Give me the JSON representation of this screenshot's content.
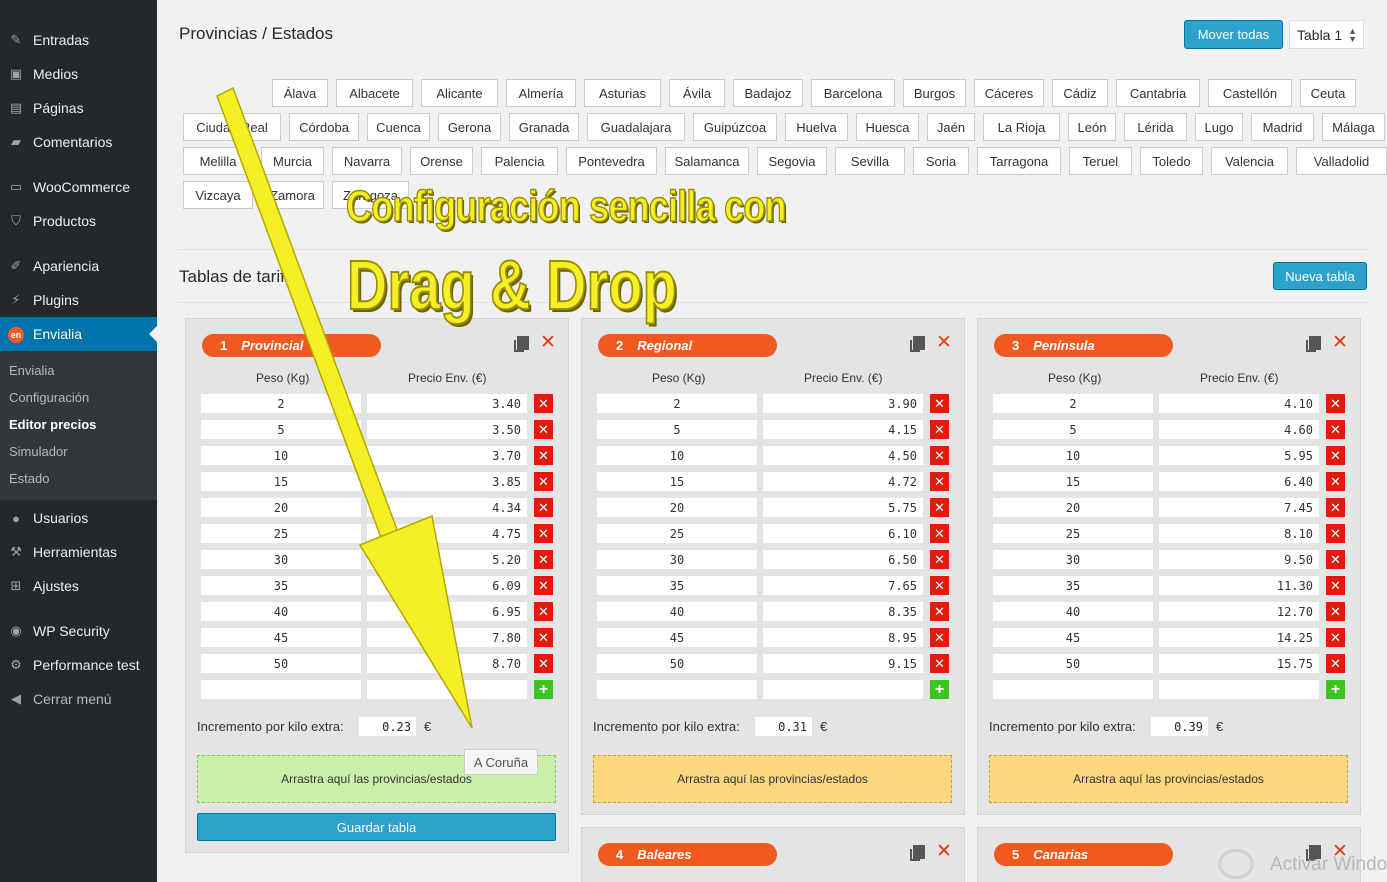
{
  "sidebar": {
    "items": [
      {
        "label": "Entradas",
        "icon": "pushpin-icon"
      },
      {
        "label": "Medios",
        "icon": "media-icon"
      },
      {
        "label": "Páginas",
        "icon": "page-icon"
      },
      {
        "label": "Comentarios",
        "icon": "comment-icon"
      },
      {
        "label": "WooCommerce",
        "icon": "woocommerce-icon"
      },
      {
        "label": "Productos",
        "icon": "cart-icon"
      },
      {
        "label": "Apariencia",
        "icon": "brush-icon"
      },
      {
        "label": "Plugins",
        "icon": "plug-icon"
      },
      {
        "label": "Envialia",
        "icon": "envialia-icon",
        "badge": "en"
      },
      {
        "label": "Usuarios",
        "icon": "user-icon"
      },
      {
        "label": "Herramientas",
        "icon": "wrench-icon"
      },
      {
        "label": "Ajustes",
        "icon": "settings-icon"
      },
      {
        "label": "WP Security",
        "icon": "security-icon"
      },
      {
        "label": "Performance test",
        "icon": "gear-icon"
      },
      {
        "label": "Cerrar menú",
        "icon": "collapse-icon"
      }
    ],
    "submenu": [
      "Envialia",
      "Configuración",
      "Editor precios",
      "Simulador",
      "Estado"
    ]
  },
  "provinces": {
    "title": "Provincias / Estados",
    "move_all_label": "Mover todas",
    "table_select": "Tabla 1",
    "rows": [
      [
        "Álava",
        "Albacete",
        "Alicante",
        "Almería",
        "Asturias",
        "Ávila",
        "Badajoz",
        "Barcelona",
        "Burgos",
        "Cáceres",
        "Cádiz",
        "Cantabria",
        "Castellón",
        "Ceuta"
      ],
      [
        "Ciudad Real",
        "Córdoba",
        "Cuenca",
        "Gerona",
        "Granada",
        "Guadalajara",
        "Guipúzcoa",
        "Huelva",
        "Huesca",
        "Jaén",
        "La Rioja",
        "León",
        "Lérida",
        "Lugo",
        "Madrid",
        "Málaga"
      ],
      [
        "Melilla",
        "Murcia",
        "Navarra",
        "Orense",
        "Palencia",
        "Pontevedra",
        "Salamanca",
        "Segovia",
        "Sevilla",
        "Soria",
        "Tarragona",
        "Teruel",
        "Toledo",
        "Valencia",
        "Valladolid"
      ],
      [
        "Vizcaya",
        "Zamora",
        "Zaragoza"
      ]
    ]
  },
  "tables_section": {
    "title": "Tablas de tarifas",
    "new_table_label": "Nueva tabla",
    "weight_header": "Peso (Kg)",
    "price_header": "Precio Env. (€)",
    "increment_label": "Incremento por kilo extra:",
    "currency": "€",
    "dropzone_label": "Arrastra aquí las provincias/estados",
    "save_label": "Guardar tabla",
    "dragging_chip": "A Coruña",
    "weights": [
      "2",
      "5",
      "10",
      "15",
      "20",
      "25",
      "30",
      "35",
      "40",
      "45",
      "50"
    ],
    "cards": [
      {
        "num": "1",
        "name": "Provincial",
        "prices": [
          "3.40",
          "3.50",
          "3.70",
          "3.85",
          "4.34",
          "4.75",
          "5.20",
          "6.09",
          "6.95",
          "7.80",
          "8.70"
        ],
        "increment": "0.23"
      },
      {
        "num": "2",
        "name": "Regional",
        "prices": [
          "3.90",
          "4.15",
          "4.50",
          "4.72",
          "5.75",
          "6.10",
          "6.50",
          "7.65",
          "8.35",
          "8.95",
          "9.15"
        ],
        "increment": "0.31"
      },
      {
        "num": "3",
        "name": "Península",
        "prices": [
          "4.10",
          "4.60",
          "5.95",
          "6.40",
          "7.45",
          "8.10",
          "9.50",
          "11.30",
          "12.70",
          "14.25",
          "15.75"
        ],
        "increment": "0.39"
      },
      {
        "num": "4",
        "name": "Baleares"
      },
      {
        "num": "5",
        "name": "Canarias"
      }
    ]
  },
  "overlay": {
    "line1": "Configuración sencilla con",
    "line2": "Drag & Drop",
    "arrow_color": "#f6ef26"
  },
  "watermark": "Activar Windows",
  "colors": {
    "accent": "#0073aa",
    "button": "#2ea2cc",
    "pill": "#f05a20",
    "delete": "#e7190c",
    "add": "#3cc41f"
  }
}
